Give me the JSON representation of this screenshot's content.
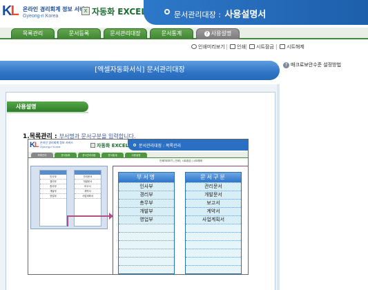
{
  "header": {
    "logo_mark_k": "K",
    "logo_mark_l": "L",
    "logo_line1": "온라인 경리회계 정보 서비스",
    "logo_line2": "Gyeong-ri Korea",
    "brand_icon": "X",
    "brand_name": "자동화 EXCEL",
    "breadcrumb": "문서관리대장 :",
    "page_title": "사용설명서"
  },
  "tabs": [
    {
      "label": "목록관리"
    },
    {
      "label": "문서등록"
    },
    {
      "label": "문서관리대장"
    },
    {
      "label": "문서통계"
    },
    {
      "label": "사용설명",
      "active": true,
      "icon": "question-icon"
    }
  ],
  "toolbar": {
    "preview": "인쇄미리보기",
    "print": "인쇄",
    "sheet_protect": "시트잠금",
    "sheet_unprotect": "시트해제"
  },
  "macro_button": "매크로보안수준 설정방법",
  "banner_title": "[엑셀자동화서식] 문서관리대장",
  "section_title": "사용설명",
  "step1": {
    "number": "1.",
    "title": "목록관리 :",
    "highlight": "부서명",
    "rest": "과 문서구분을 입력합니다."
  },
  "inset": {
    "logo_line1": "온라인 경리회계 정보 서비스",
    "logo_line2": "Gyeong-ri Korea",
    "brand": "자동화 EXCEL",
    "title": "문서관리대장 : 목록관리",
    "tabs": [
      "목록관리",
      "문서등록",
      "문서관리대장",
      "문서통계",
      "사용설명"
    ],
    "tools": "인쇄미리보기 | 인쇄 | 시트잠금 | 시트해제",
    "small_dept": [
      "부서명",
      "인사부",
      "경리부",
      "총무부",
      "개발부",
      "영업부"
    ],
    "small_doc": [
      "문서구분",
      "관리문서",
      "개발문서",
      "보고서",
      "계약서",
      "사업계획서"
    ]
  },
  "dept_table": {
    "header": "부서명",
    "rows": [
      "인사부",
      "경리부",
      "총무부",
      "개발부",
      "영업부",
      "",
      "",
      "",
      "",
      "",
      ""
    ]
  },
  "doc_table": {
    "header": "문서구분",
    "rows": [
      "관리문서",
      "개발문서",
      "보고서",
      "계약서",
      "사업계획서",
      "",
      "",
      "",
      "",
      "",
      ""
    ]
  }
}
